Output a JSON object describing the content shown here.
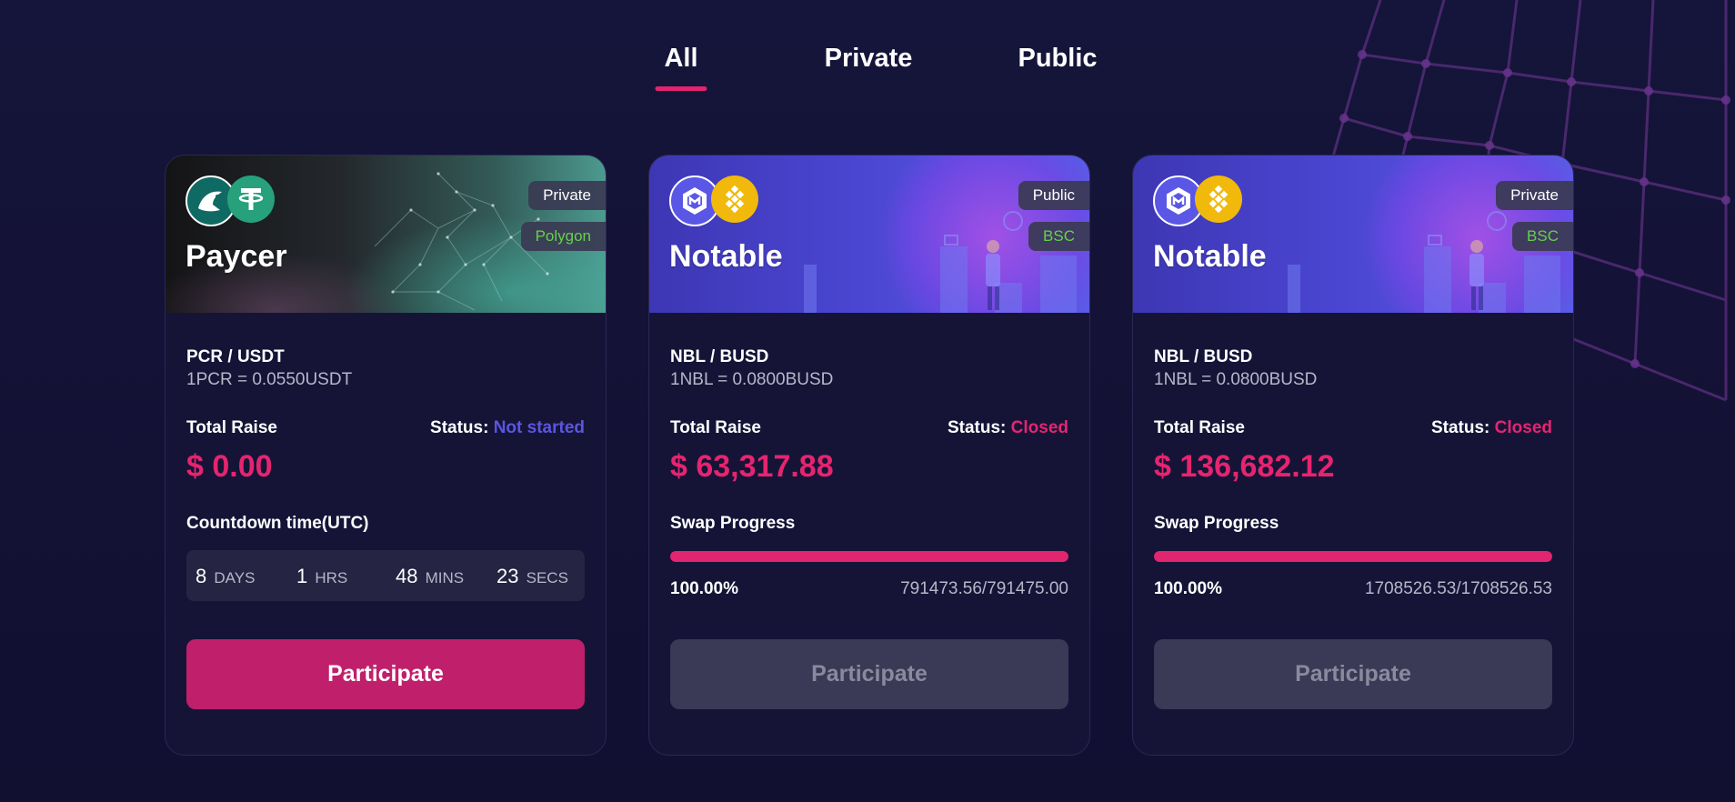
{
  "tabs": [
    {
      "label": "All",
      "active": true
    },
    {
      "label": "Private",
      "active": false
    },
    {
      "label": "Public",
      "active": false
    }
  ],
  "colors": {
    "accent": "#e6246f",
    "status_not_started": "#5b55e0",
    "status_closed": "#e6246f",
    "chain_text": "#66d14a"
  },
  "cards": [
    {
      "name": "Paycer",
      "access": "Private",
      "chain": "Polygon",
      "icons": [
        "paycer-icon",
        "tether-icon"
      ],
      "pair": "PCR / USDT",
      "rate": "1PCR = 0.0550USDT",
      "total_raise_label": "Total Raise",
      "status_label": "Status:",
      "status": "Not started",
      "total_raise": "$ 0.00",
      "section_label": "Countdown time(UTC)",
      "countdown": [
        {
          "value": "8",
          "unit": "DAYS"
        },
        {
          "value": "1",
          "unit": "HRS"
        },
        {
          "value": "48",
          "unit": "MINS"
        },
        {
          "value": "23",
          "unit": "SECS"
        }
      ],
      "button": "Participate",
      "button_enabled": true
    },
    {
      "name": "Notable",
      "access": "Public",
      "chain": "BSC",
      "icons": [
        "notable-icon",
        "busd-icon"
      ],
      "pair": "NBL / BUSD",
      "rate": "1NBL = 0.0800BUSD",
      "total_raise_label": "Total Raise",
      "status_label": "Status:",
      "status": "Closed",
      "total_raise": "$ 63,317.88",
      "section_label": "Swap Progress",
      "progress": 1.0,
      "progress_text": "100.00%",
      "amount_text": "791473.56/791475.00",
      "button": "Participate",
      "button_enabled": false
    },
    {
      "name": "Notable",
      "access": "Private",
      "chain": "BSC",
      "icons": [
        "notable-icon",
        "busd-icon"
      ],
      "pair": "NBL / BUSD",
      "rate": "1NBL = 0.0800BUSD",
      "total_raise_label": "Total Raise",
      "status_label": "Status:",
      "status": "Closed",
      "total_raise": "$ 136,682.12",
      "section_label": "Swap Progress",
      "progress": 1.0,
      "progress_text": "100.00%",
      "amount_text": "1708526.53/1708526.53",
      "button": "Participate",
      "button_enabled": false
    }
  ]
}
